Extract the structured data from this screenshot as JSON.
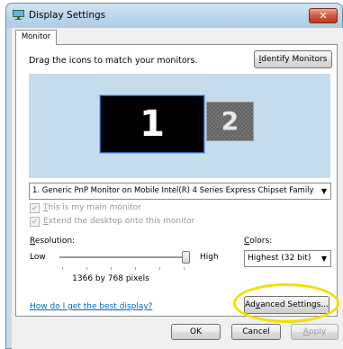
{
  "window": {
    "title": "Display Settings",
    "close_glyph": "✕"
  },
  "icons": {
    "app": "display-settings-icon",
    "close": "close-icon",
    "dropdown": "chevron-down-icon",
    "check": "checkmark-icon"
  },
  "tabs": [
    {
      "label": "Monitor",
      "selected": true
    }
  ],
  "arrangement": {
    "instructions": "Drag the icons to match your monitors.",
    "identify_button": {
      "prefix": "",
      "mnemonic": "I",
      "rest": "dentify Monitors"
    },
    "monitors": [
      {
        "number": "1",
        "selected": true
      },
      {
        "number": "2",
        "selected": false
      }
    ]
  },
  "monitor_select": {
    "value": "1. Generic PnP Monitor on Mobile Intel(R) 4 Series Express Chipset Family"
  },
  "checkboxes": [
    {
      "mnemonic": "T",
      "rest": "his is my main monitor",
      "checked": true,
      "enabled": false
    },
    {
      "mnemonic": "E",
      "rest": "xtend the desktop onto this monitor",
      "checked": true,
      "enabled": false
    }
  ],
  "resolution": {
    "label_mnemonic": "R",
    "label_rest": "esolution:",
    "low_label": "Low",
    "high_label": "High",
    "slider_level": 1.0,
    "value_text": "1366 by 768 pixels"
  },
  "colors": {
    "label_mnemonic": "C",
    "label_rest": "olors:",
    "selected": "Highest (32 bit)"
  },
  "help_link": "How do I get the best display?",
  "advanced_button": {
    "prefix": "Ad",
    "mnemonic": "v",
    "rest": "anced Settings..."
  },
  "footer": {
    "ok": "OK",
    "cancel": "Cancel",
    "apply_prefix": "",
    "apply_mnemonic": "A",
    "apply_rest": "pply"
  },
  "colors_palette": {
    "arrangement_bg": "#c6dced",
    "highlight": "#f2e000",
    "link": "#0066cc"
  }
}
